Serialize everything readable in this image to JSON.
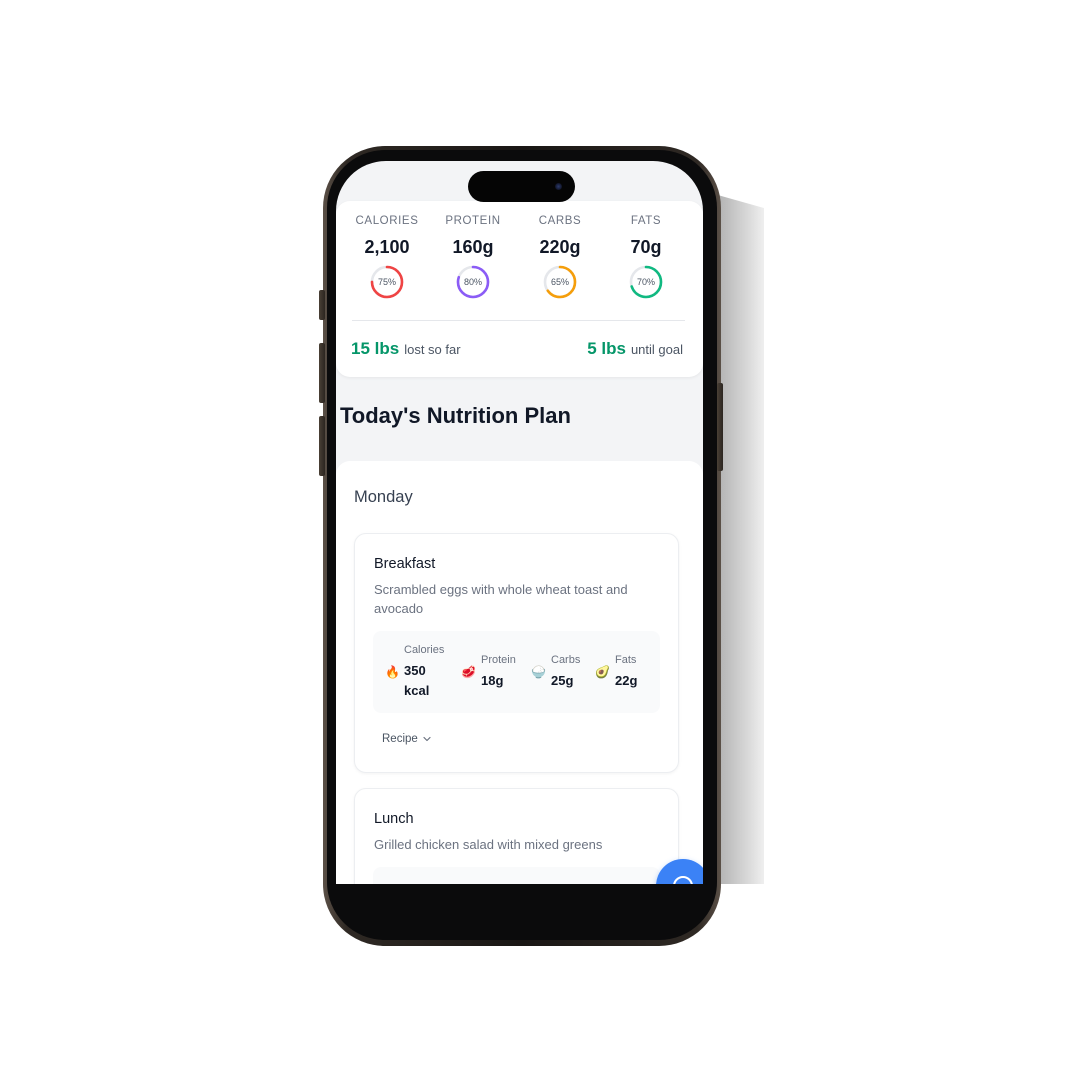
{
  "macros": [
    {
      "label": "CALORIES",
      "value": "2,100",
      "percent": 75,
      "percent_text": "75%",
      "color": "#ef4444"
    },
    {
      "label": "PROTEIN",
      "value": "160g",
      "percent": 80,
      "percent_text": "80%",
      "color": "#8b5cf6"
    },
    {
      "label": "CARBS",
      "value": "220g",
      "percent": 65,
      "percent_text": "65%",
      "color": "#f59e0b"
    },
    {
      "label": "FATS",
      "value": "70g",
      "percent": 70,
      "percent_text": "70%",
      "color": "#10b981"
    }
  ],
  "progress": {
    "lost_value": "15 lbs",
    "lost_label": "lost so far",
    "remaining_value": "5 lbs",
    "remaining_label": "until goal",
    "accent_color": "#059669"
  },
  "plan": {
    "title": "Today's Nutrition Plan",
    "day": "Monday",
    "meals": [
      {
        "name": "Breakfast",
        "description": "Scrambled eggs with whole wheat toast and avocado",
        "nutrients": [
          {
            "icon": "fire-icon",
            "emoji": "🔥",
            "label": "Calories",
            "value": "350 kcal"
          },
          {
            "icon": "meat-icon",
            "emoji": "🥩",
            "label": "Protein",
            "value": "18g"
          },
          {
            "icon": "rice-icon",
            "emoji": "🍚",
            "label": "Carbs",
            "value": "25g"
          },
          {
            "icon": "avocado-icon",
            "emoji": "🥑",
            "label": "Fats",
            "value": "22g"
          }
        ],
        "recipe_label": "Recipe"
      },
      {
        "name": "Lunch",
        "description": "Grilled chicken salad with mixed greens"
      }
    ]
  },
  "fab": {
    "icon": "chat-icon",
    "color": "#3b82f6"
  }
}
